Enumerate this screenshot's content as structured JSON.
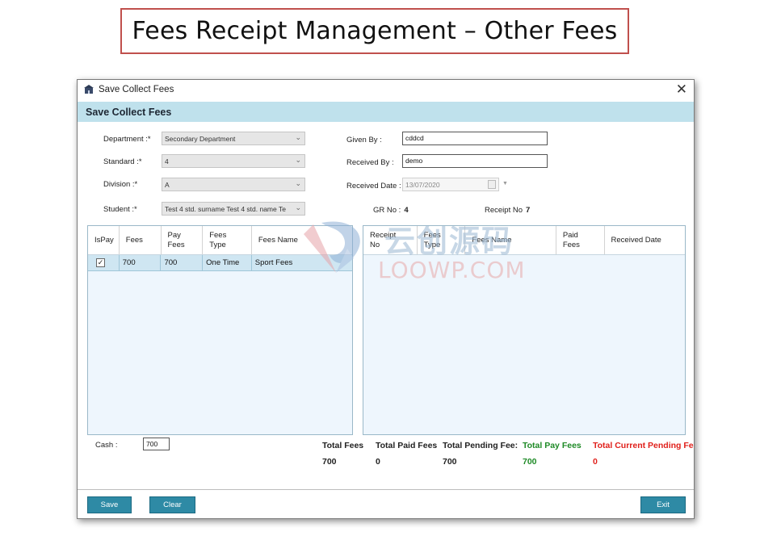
{
  "slide_title": "Fees Receipt Management – Other Fees",
  "window": {
    "title": "Save Collect Fees",
    "close_glyph": "✕",
    "header": "Save Collect Fees",
    "app_icon": "school-icon"
  },
  "form": {
    "department": {
      "label": "Department :*",
      "value": "Secondary Department"
    },
    "standard": {
      "label": "Standard :*",
      "value": "4"
    },
    "division": {
      "label": "Division :*",
      "value": "A"
    },
    "student": {
      "label": "Student :*",
      "value": "Test 4 std. surname Test 4 std. name Te"
    },
    "given_by": {
      "label": "Given By :",
      "value": "cddcd"
    },
    "received_by": {
      "label": "Received By :",
      "value": "demo"
    },
    "received_date": {
      "label": "Received Date :",
      "value": "13/07/2020"
    },
    "gr_no": {
      "label": "GR No :",
      "value": "4"
    },
    "receipt_no": {
      "label": "Receipt No",
      "value": "7"
    },
    "cash": {
      "label": "Cash :",
      "value": "700"
    }
  },
  "left_grid": {
    "columns": [
      "IsPay",
      "Fees",
      "Pay\nFees",
      "Fees\nType",
      "Fees Name"
    ],
    "rows": [
      {
        "is_pay": true,
        "fees": "700",
        "pay_fees": "700",
        "fees_type": "One Time",
        "fees_name": "Sport Fees"
      }
    ]
  },
  "right_grid": {
    "columns": [
      "Receipt\nNo",
      "Fees\nType",
      "Fees Name",
      "Paid\nFees",
      "Received Date"
    ],
    "rows": []
  },
  "totals": {
    "total_fees": {
      "label": "Total Fees",
      "value": "700"
    },
    "total_paid_fees": {
      "label": "Total Paid Fees",
      "value": "0"
    },
    "total_pending_fees": {
      "label": "Total Pending Fee:",
      "value": "700"
    },
    "total_pay_fees": {
      "label": "Total Pay Fees",
      "value": "700"
    },
    "total_current_pending": {
      "label": "Total Current Pending Fe",
      "value": "0"
    }
  },
  "buttons": {
    "save": "Save",
    "clear": "Clear",
    "exit": "Exit"
  },
  "watermark": {
    "cn": "云创源码",
    "en": "LOOWP.COM"
  },
  "colors": {
    "header_band": "#bfe1ec",
    "button": "#2e8aa5",
    "green": "#1e8a26",
    "red": "#e0201b",
    "title_border": "#c0504d"
  }
}
